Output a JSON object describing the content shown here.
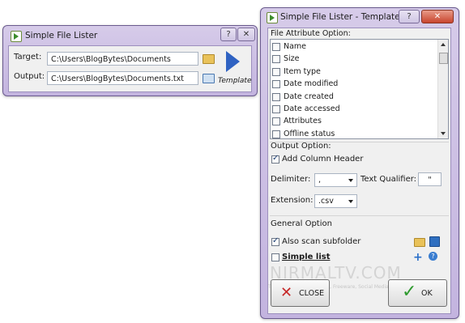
{
  "lister": {
    "title": "Simple File Lister",
    "target_label": "Target:",
    "target_value": "C:\\Users\\BlogBytes\\Documents",
    "output_label": "Output:",
    "output_value": "C:\\Users\\BlogBytes\\Documents.txt",
    "template_label": "Template",
    "close_glyph": "✕",
    "help_glyph": "?"
  },
  "template": {
    "title": "Simple File Lister - Template",
    "help_glyph": "?",
    "close_glyph": "✕",
    "file_attr_label": "File Attribute Option:",
    "attributes": [
      {
        "label": "Name",
        "checked": false
      },
      {
        "label": "Size",
        "checked": false
      },
      {
        "label": "Item type",
        "checked": false
      },
      {
        "label": "Date modified",
        "checked": false
      },
      {
        "label": "Date created",
        "checked": false
      },
      {
        "label": "Date accessed",
        "checked": false
      },
      {
        "label": "Attributes",
        "checked": false
      },
      {
        "label": "Offline status",
        "checked": false
      }
    ],
    "output_option_label": "Output Option:",
    "add_column_header_label": "Add Column Header",
    "add_column_header_checked": true,
    "delimiter_label": "Delimiter:",
    "delimiter_value": ",",
    "text_qualifier_label": "Text Qualifier:",
    "text_qualifier_value": "\"",
    "extension_label": "Extension:",
    "extension_value": ".csv",
    "general_option_label": "General Option",
    "scan_subfolder_label": "Also scan subfolder",
    "scan_subfolder_checked": true,
    "simple_list_label": "Simple list",
    "simple_list_checked": false,
    "close_button_label": "CLOSE",
    "ok_button_label": "OK"
  },
  "watermark": {
    "brand": "NIRMALTV.COM",
    "tagline": "Tech News, Windows Tips, Freeware, Social Media & Internet"
  }
}
